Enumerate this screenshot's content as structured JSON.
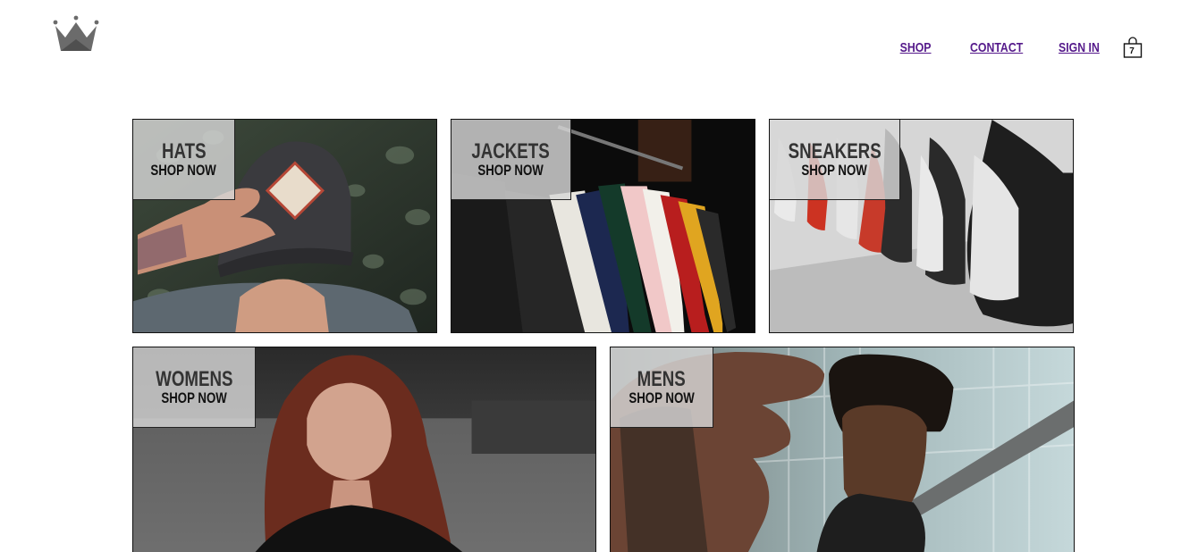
{
  "header": {
    "nav": [
      {
        "label": "SHOP"
      },
      {
        "label": "CONTACT"
      },
      {
        "label": "SIGN IN"
      }
    ],
    "cart": {
      "count": "7",
      "icon": "shopping-bag-icon"
    },
    "logo": {
      "icon": "crown-icon",
      "color": "#6b6b6b"
    },
    "link_color": "#551a8b"
  },
  "categories": [
    {
      "title": "HATS",
      "cta": "SHOP NOW"
    },
    {
      "title": "JACKETS",
      "cta": "SHOP NOW"
    },
    {
      "title": "SNEAKERS",
      "cta": "SHOP NOW"
    },
    {
      "title": "WOMENS",
      "cta": "SHOP NOW"
    },
    {
      "title": "MENS",
      "cta": "SHOP NOW"
    }
  ]
}
